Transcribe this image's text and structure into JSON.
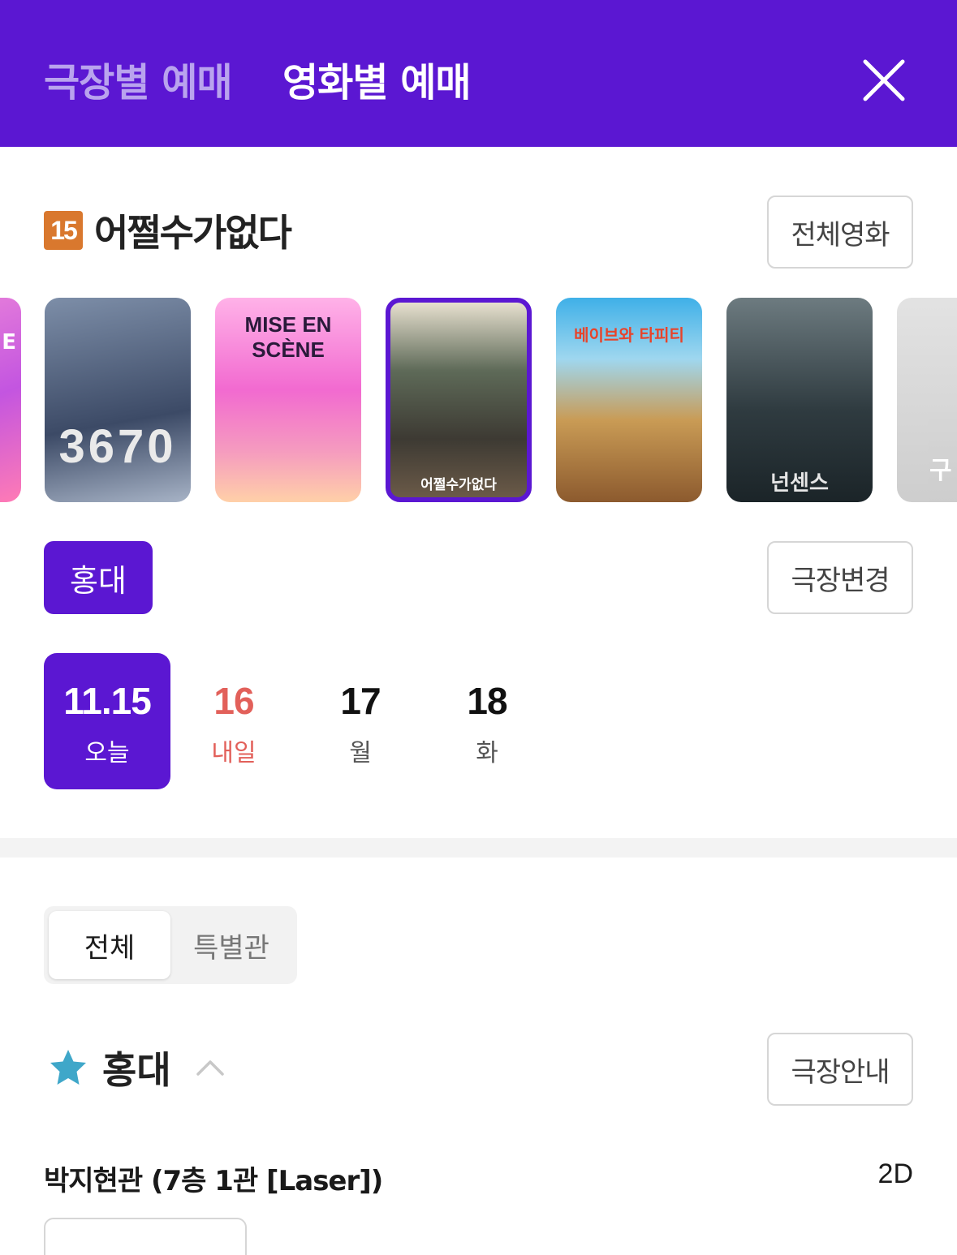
{
  "header": {
    "tab_theater": "극장별 예매",
    "tab_movie": "영화별 예매"
  },
  "movie": {
    "age_rating": "15",
    "title": "어쩔수가없다",
    "all_movies_label": "전체영화"
  },
  "posters": [
    {
      "label": "E",
      "selected": false
    },
    {
      "label": "3670",
      "selected": false
    },
    {
      "label": "MISE EN SCÈNE",
      "selected": false
    },
    {
      "label": "어쩔수가없다",
      "selected": true
    },
    {
      "label": "베이브와 타피티",
      "selected": false
    },
    {
      "label": "넌센스",
      "selected": false
    },
    {
      "label": "구",
      "selected": false
    }
  ],
  "theater": {
    "selected": "홍대",
    "change_label": "극장변경"
  },
  "dates": [
    {
      "num": "11.15",
      "day": "오늘"
    },
    {
      "num": "16",
      "day": "내일"
    },
    {
      "num": "17",
      "day": "월"
    },
    {
      "num": "18",
      "day": "화"
    }
  ],
  "filter": {
    "all": "전체",
    "special": "특별관"
  },
  "theater_section": {
    "name": "홍대",
    "info_label": "극장안내"
  },
  "screen": {
    "name": "박지현관 (7층 1관 [Laser])",
    "format": "2D"
  },
  "colors": {
    "brand": "#5b17d2",
    "tomorrow": "#e2605a",
    "star": "#3fa7c9"
  }
}
